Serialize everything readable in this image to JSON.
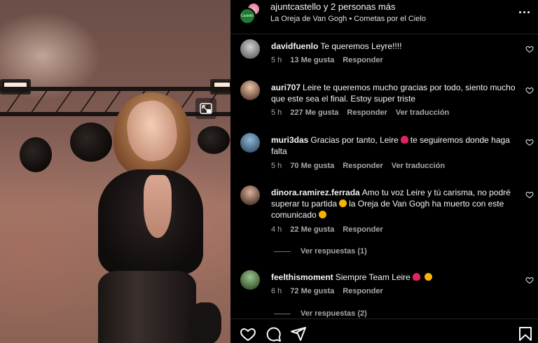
{
  "header": {
    "title": "ajuntcastello y 2 personas más",
    "subtitle": "La Oreja de Van Gogh • Cometas por el Cielo",
    "avatar_badge_text": "Castelló"
  },
  "comments": [
    {
      "user": "davidfuenlo",
      "text": "Te queremos Leyre!!!!",
      "time": "5 h",
      "likes": "13 Me gusta",
      "reply": "Responder",
      "translate": ""
    },
    {
      "user": "auri707",
      "text": "Leire te queremos mucho gracias por todo, siento mucho que este sea el final. Estoy super triste",
      "time": "5 h",
      "likes": "227 Me gusta",
      "reply": "Responder",
      "translate": "Ver traducción"
    },
    {
      "user": "muri3das",
      "text_a": "Gracias por tanto, Leire",
      "text_b": "te seguiremos donde haga falta",
      "time": "5 h",
      "likes": "70 Me gusta",
      "reply": "Responder",
      "translate": "Ver traducción"
    },
    {
      "user": "dinora.ramirez.ferrada",
      "text_a": "Amo tu voz Leire y tú carisma, no podré superar tu partida",
      "text_b": "la Oreja de Van Gogh ha muerto con este comunicado",
      "time": "4 h",
      "likes": "22 Me gusta",
      "reply": "Responder",
      "translate": "",
      "view_replies": "Ver respuestas (1)"
    },
    {
      "user": "feelthismoment",
      "text": "Siempre Team Leire",
      "time": "6 h",
      "likes": "72 Me gusta",
      "reply": "Responder",
      "translate": "",
      "view_replies": "Ver respuestas (2)"
    }
  ],
  "colors": {
    "background": "#000000",
    "text": "#f5f5f5",
    "muted": "#a8a8a8",
    "divider": "#262626",
    "emoji_heart": "#e0245e",
    "emoji_face": "#f4b400"
  },
  "icons": [
    "heart-icon",
    "comment-icon",
    "share-icon",
    "bookmark-icon",
    "more-options-icon",
    "expand-icon"
  ]
}
